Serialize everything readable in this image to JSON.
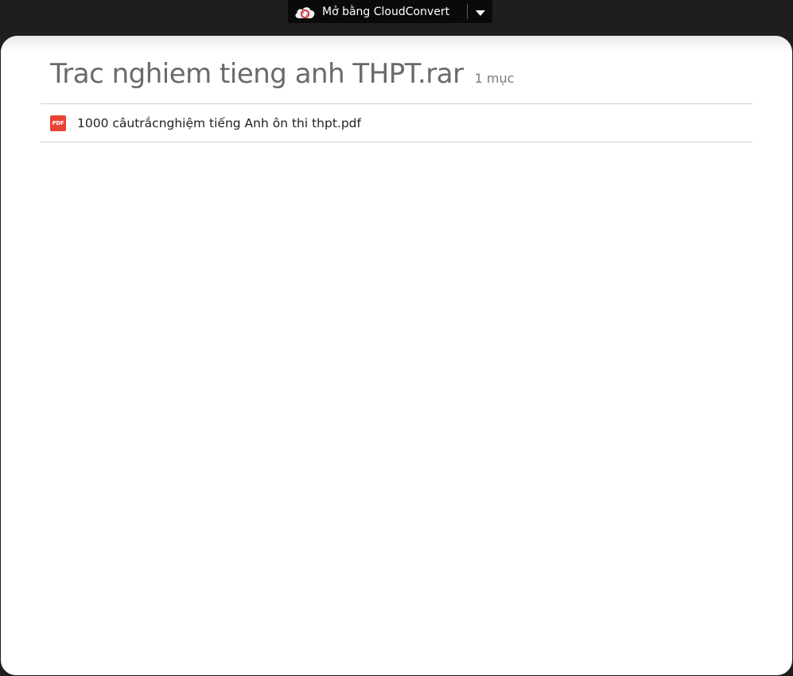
{
  "toolbar": {
    "open_with_label": "Mở bằng CloudConvert",
    "app_icon": "cloudconvert-icon",
    "dropdown_icon": "caret-down-icon"
  },
  "archive": {
    "title": "Trac nghiem tieng anh THPT.rar",
    "item_count": "1 mục"
  },
  "files": [
    {
      "icon": "pdf-icon",
      "icon_text": "PDF",
      "name": "1000 câutrắcnghiệm tiếng Anh ôn thi thpt.pdf"
    }
  ],
  "colors": {
    "background": "#1e1e1e",
    "panel": "#ffffff",
    "pdf_red": "#e94335",
    "title_gray": "#6a6a6a"
  }
}
